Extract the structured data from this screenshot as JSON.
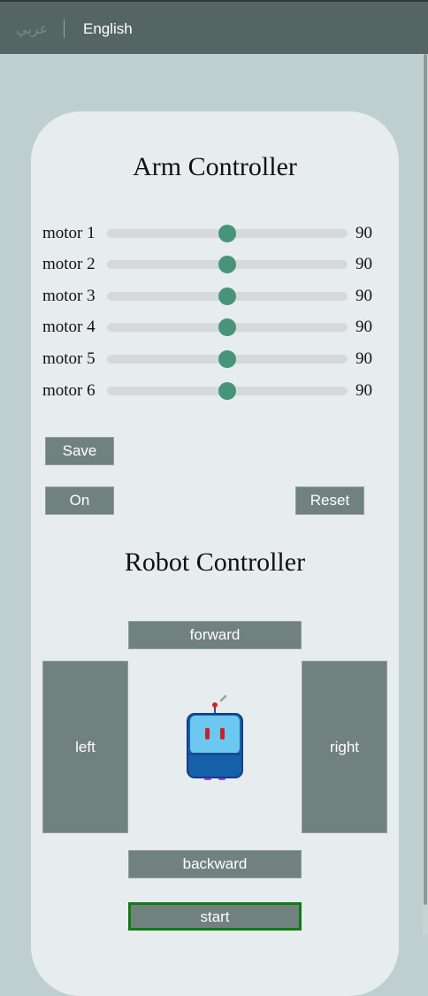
{
  "topbar": {
    "lang_arabic": "عربي",
    "lang_english": "English"
  },
  "arm": {
    "title": "Arm Controller",
    "range_max": 180,
    "motors": [
      {
        "label": "motor 1",
        "value": "90"
      },
      {
        "label": "motor 2",
        "value": "90"
      },
      {
        "label": "motor 3",
        "value": "90"
      },
      {
        "label": "motor 4",
        "value": "90"
      },
      {
        "label": "motor 5",
        "value": "90"
      },
      {
        "label": "motor 6",
        "value": "90"
      }
    ],
    "save_label": "Save",
    "on_label": "On",
    "reset_label": "Reset"
  },
  "robot": {
    "title": "Robot Controller",
    "forward_label": "forward",
    "left_label": "left",
    "right_label": "right",
    "backward_label": "backward",
    "start_label": "start"
  },
  "colors": {
    "slider_thumb": "#479479",
    "button_bg": "#71827e",
    "start_border": "#137a15"
  }
}
